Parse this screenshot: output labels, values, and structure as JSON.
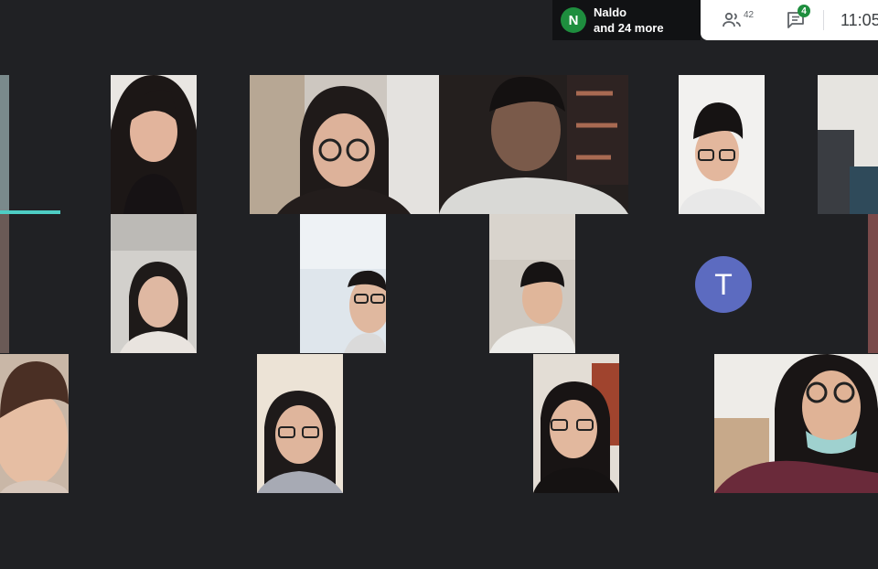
{
  "presence": {
    "avatar_letter": "N",
    "name_line": "Naldo",
    "more_line": "and 24 more"
  },
  "toolbar": {
    "people_count": "42",
    "chat_badge": "4",
    "time": "11:05"
  },
  "participants": {
    "tile_avatar_letter": "T"
  },
  "colors": {
    "accent_green": "#1e8e3e",
    "avatar_purple": "#5c6bc0",
    "speaking": "#4ecdc4",
    "background": "#202124"
  }
}
